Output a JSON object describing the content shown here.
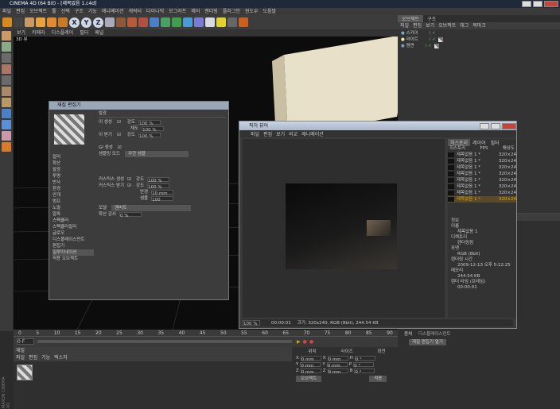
{
  "window": {
    "title": "CINEMA 4D (64 Bit) - [제목없음 1.c4d]"
  },
  "menu": [
    "파일",
    "편집",
    "오브젝트",
    "툴",
    "선택",
    "구조",
    "기능",
    "애니메이션",
    "캐릭터",
    "다이나믹",
    "모그라프",
    "헤어",
    "렌더링",
    "플러그인",
    "윈도우",
    "도움말"
  ],
  "axes": [
    "X",
    "Y",
    "Z"
  ],
  "viewport": {
    "menu": [
      "보기",
      "카메라",
      "디스플레이",
      "필터",
      "패널"
    ],
    "label": "3D 뷰"
  },
  "objmanager": {
    "tabs": [
      "오브젝트",
      "구조"
    ],
    "menu": [
      "파일",
      "편집",
      "보기",
      "오브젝트",
      "태그",
      "북마크"
    ],
    "items": [
      "스카이",
      "라이트",
      "평면"
    ]
  },
  "mated": {
    "title": "재질 편집기",
    "section": "발광",
    "channels": [
      "컬러",
      "확산",
      "발광",
      "투명",
      "반사",
      "환경",
      "안개",
      "범프",
      "노멀",
      "알파",
      "스펙큘러",
      "스펙큘러컬러",
      "글로우",
      "디스플레이스먼트",
      "편집기",
      "일루미네이션",
      "적용 오브젝트"
    ],
    "labels": {
      "glow1": "이 생성",
      "glow2": "이 받기",
      "bright1": "강도",
      "bright2": "채도",
      "pct": "100 %",
      "mode": "샘플링 모드",
      "sample": "무한 샘플",
      "gi": "GI 생성",
      "caustic1": "커스틱스 생성",
      "caustic2": "커스틱스 받기",
      "model": "모델",
      "modelval": "램버트",
      "diffuse": "확산 감쇠",
      "val0": "0 %",
      "radius": "반경",
      "rval": "10 mm",
      "samples": "샘플",
      "sval": "100"
    }
  },
  "pv": {
    "title": "픽처 뷰어",
    "menu": [
      "파일",
      "편집",
      "보기",
      "비교",
      "애니메이션"
    ],
    "tabs": [
      "히스토리",
      "레이어",
      "필터"
    ],
    "cols": [
      "히스토리",
      "FPS",
      "해상도"
    ],
    "rows": [
      [
        "제목없음 1 *",
        "",
        "320×24"
      ],
      [
        "제목없음 1 *",
        "",
        "320×24"
      ],
      [
        "제목없음 1 *",
        "",
        "320×24"
      ],
      [
        "제목없음 1 *",
        "",
        "320×24"
      ],
      [
        "제목없음 1 *",
        "",
        "320×24"
      ],
      [
        "제목없음 1 *",
        "",
        "320×24"
      ],
      [
        "제목없음 1 *",
        "",
        "320×24"
      ],
      [
        "제목없음 1 *",
        "",
        "320×24"
      ]
    ],
    "info": [
      "정보",
      "이름",
      "제목없음 1",
      "디렉토리",
      "렌더링됨",
      "포맷",
      "RGB (8bit)",
      "렌더링 시간",
      "2009-12-13 오후 5:12:25",
      "메모리",
      "244.54 KB",
      "렌더 타임 (프레임)",
      "00:00:01"
    ],
    "status": {
      "zoom": "100 %",
      "time": "00:00:01",
      "size": "크기: 320x240, RGB (8bit), 244.54 KB"
    }
  },
  "timeline": {
    "ticks": [
      "0",
      "5",
      "10",
      "15",
      "20",
      "25",
      "30",
      "35",
      "40",
      "45",
      "50",
      "55",
      "60",
      "65",
      "70",
      "75",
      "80",
      "85",
      "90"
    ],
    "frame": "0 F"
  },
  "materials": {
    "menu": [
      "파일",
      "편집",
      "기능",
      "텍스처"
    ],
    "tab": "재질"
  },
  "coords": {
    "headers": [
      "위치",
      "사이즈",
      "회전"
    ],
    "rows": [
      [
        "X",
        "0 mm",
        "X",
        "0 mm",
        "H",
        "0 °"
      ],
      [
        "Y",
        "0 mm",
        "Y",
        "0 mm",
        "P",
        "0 °"
      ],
      [
        "Z",
        "0 mm",
        "Z",
        "0 mm",
        "B",
        "0 °"
      ]
    ],
    "sel": "오브젝트",
    "apply": "적용"
  },
  "attr": {
    "items": [
      "몸체",
      "디스플레이스먼트",
      "재질 편집기 열기"
    ]
  },
  "colors": {
    "titlebar": "#1e2a3a",
    "accent": "#e0a400"
  }
}
